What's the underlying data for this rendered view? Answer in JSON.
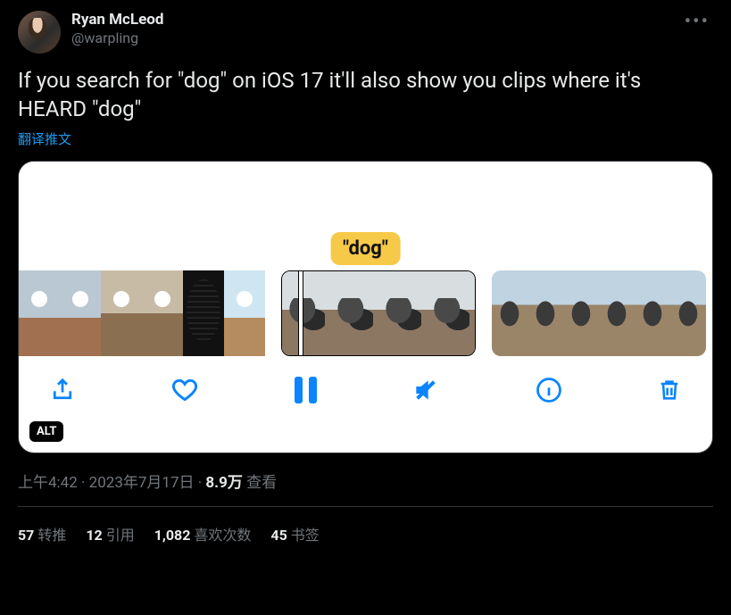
{
  "tweet": {
    "author": {
      "display_name": "Ryan McLeod",
      "handle": "@warpling"
    },
    "text": "If you search for \"dog\" on iOS 17 it'll also show you clips where it's HEARD \"dog\"",
    "translate_label": "翻译推文",
    "media": {
      "caption": "\"dog\"",
      "alt_badge": "ALT",
      "toolbar_icons": [
        "share",
        "heart",
        "pause",
        "mute",
        "info",
        "trash"
      ]
    },
    "timestamp": "上午4:42 · 2023年7月17日",
    "views_count": "8.9万",
    "views_label": "查看",
    "stats": {
      "retweets": {
        "count": "57",
        "label": "转推"
      },
      "quotes": {
        "count": "12",
        "label": "引用"
      },
      "likes": {
        "count": "1,082",
        "label": "喜欢次数"
      },
      "bookmarks": {
        "count": "45",
        "label": "书签"
      }
    }
  }
}
